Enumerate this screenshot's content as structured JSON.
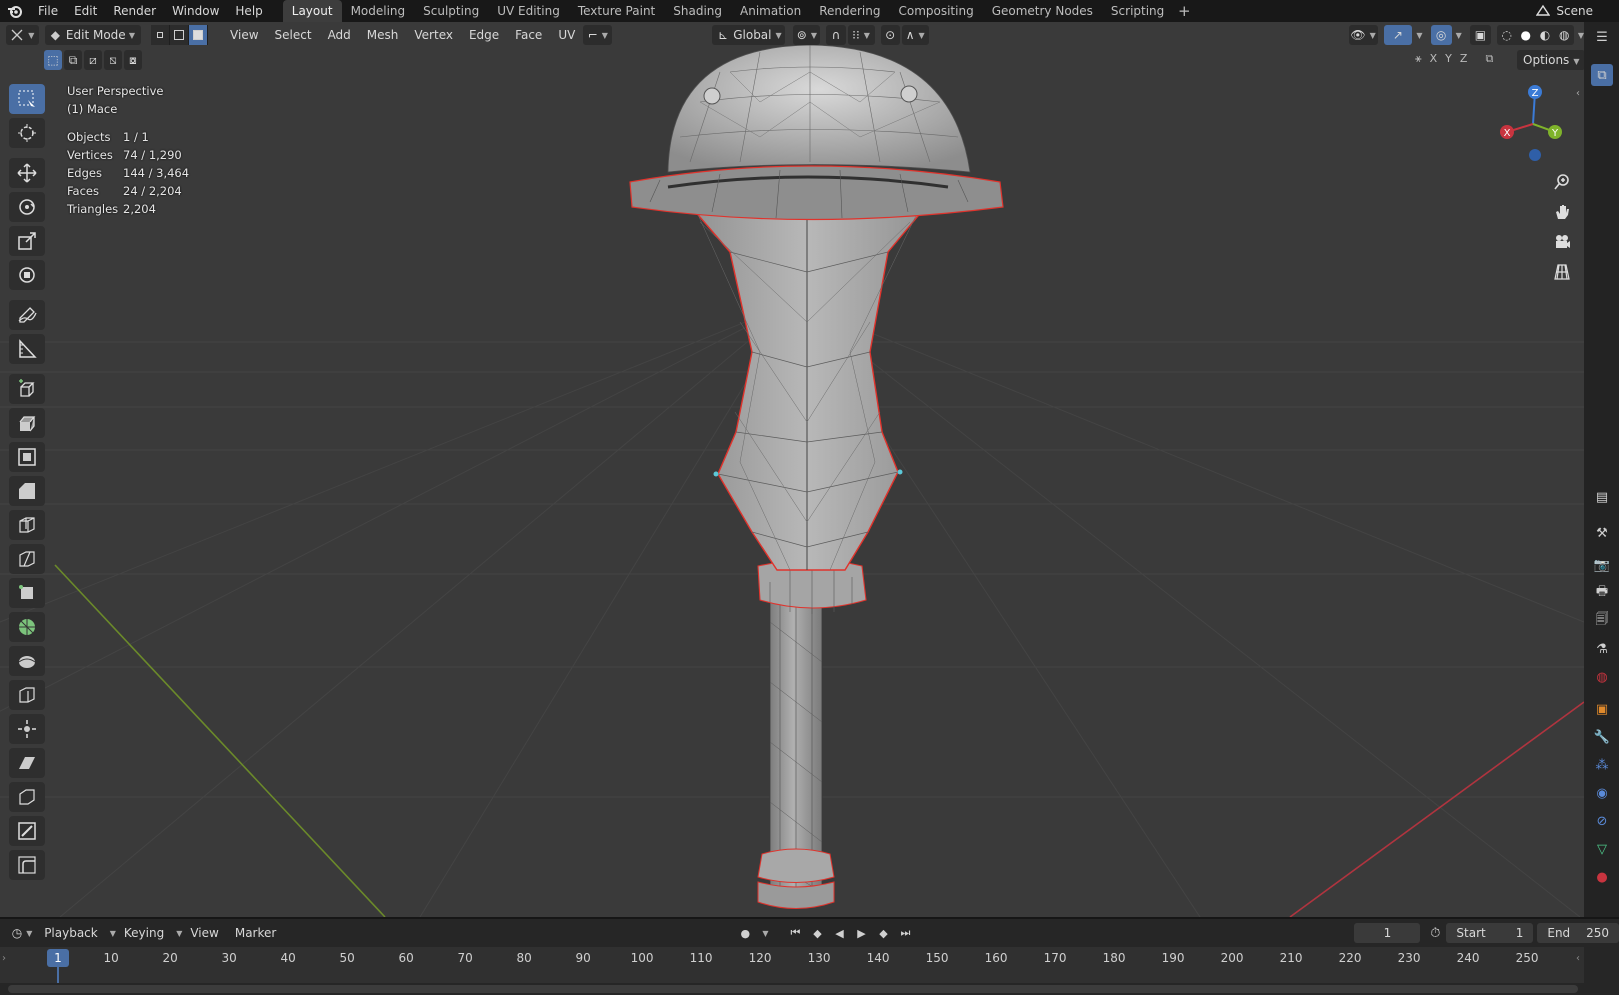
{
  "topbar": {
    "menus": [
      "File",
      "Edit",
      "Render",
      "Window",
      "Help"
    ],
    "workspaces": [
      "Layout",
      "Modeling",
      "Sculpting",
      "UV Editing",
      "Texture Paint",
      "Shading",
      "Animation",
      "Rendering",
      "Compositing",
      "Geometry Nodes",
      "Scripting"
    ],
    "active_workspace": "Layout",
    "add_tab": "+",
    "scene": "Scene"
  },
  "viewport_header": {
    "mode": "Edit Mode",
    "menus": [
      "View",
      "Select",
      "Add",
      "Mesh",
      "Vertex",
      "Edge",
      "Face",
      "UV"
    ],
    "orientation": "Global",
    "options_label": "Options",
    "axes": [
      "X",
      "Y",
      "Z"
    ]
  },
  "overlay": {
    "perspective": "User Perspective",
    "object": "(1) Mace",
    "stats": [
      {
        "label": "Objects",
        "value": "1 / 1"
      },
      {
        "label": "Vertices",
        "value": "74 / 1,290"
      },
      {
        "label": "Edges",
        "value": "144 / 3,464"
      },
      {
        "label": "Faces",
        "value": "24 / 2,204"
      },
      {
        "label": "Triangles",
        "value": "2,204"
      }
    ]
  },
  "gizmo": {
    "x": "X",
    "y": "Y",
    "z": "Z"
  },
  "colors": {
    "viewport_bg": "#3a3a3a",
    "grid": "#454545",
    "x_axis": "#b0343f",
    "y_axis": "#6b8a2a",
    "selection": "#e0332c",
    "accent": "#4a6fa5"
  },
  "timeline": {
    "menus": [
      "Playback",
      "Keying",
      "View",
      "Marker"
    ],
    "current_frame": "1",
    "start_label": "Start",
    "start": "1",
    "end_label": "End",
    "end": "250",
    "ticks": [
      "10",
      "20",
      "30",
      "40",
      "50",
      "60",
      "70",
      "80",
      "90",
      "100",
      "110",
      "120",
      "130",
      "140",
      "150",
      "160",
      "170",
      "180",
      "190",
      "200",
      "210",
      "220",
      "230",
      "240",
      "250"
    ],
    "playhead": "1"
  }
}
